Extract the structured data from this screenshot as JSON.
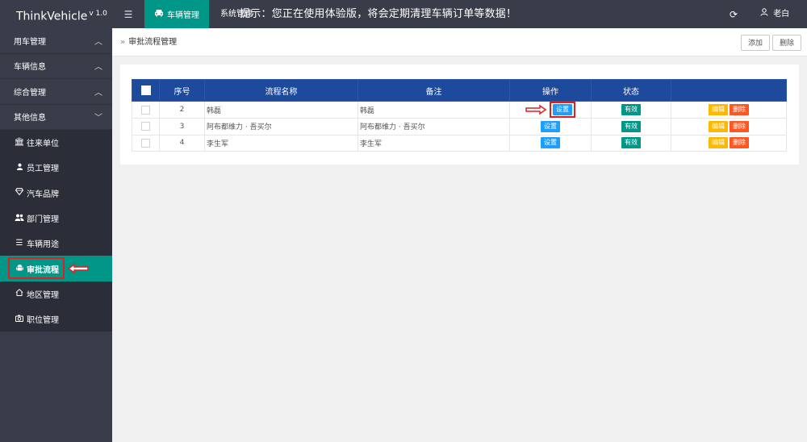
{
  "header": {
    "app_name": "ThinkVehicle",
    "version": "v 1.0",
    "menu_icon": "menu-icon",
    "active_tab": "车辆管理",
    "tab2": "系统管理",
    "notice": "提示：您正在使用体验版，将会定期清理车辆订单等数据！",
    "user": "老白",
    "accent": "#009688",
    "bg": "#393d49"
  },
  "sidebar": {
    "groups": [
      {
        "label": "用车管理",
        "icon": "chevron-up-icon"
      },
      {
        "label": "车辆信息",
        "icon": "chevron-up-icon"
      },
      {
        "label": "综合管理",
        "icon": "chevron-up-icon"
      },
      {
        "label": "其他信息",
        "icon": "chevron-down-icon"
      }
    ],
    "items": [
      {
        "label": "往来单位",
        "icon": "bank-icon"
      },
      {
        "label": "员工管理",
        "icon": "user-icon"
      },
      {
        "label": "汽车品牌",
        "icon": "diamond-icon"
      },
      {
        "label": "部门管理",
        "icon": "users-icon"
      },
      {
        "label": "车辆用途",
        "icon": "list-icon"
      },
      {
        "label": "审批流程",
        "icon": "android-icon"
      },
      {
        "label": "地区管理",
        "icon": "home-icon"
      },
      {
        "label": "职位管理",
        "icon": "camera-icon"
      }
    ]
  },
  "breadcrumb": {
    "current": "审批流程管理"
  },
  "toolbar": {
    "add": "添加",
    "delete": "删除"
  },
  "table": {
    "headers": [
      "",
      "序号",
      "流程名称",
      "备注",
      "操作",
      "状态",
      ""
    ],
    "rows": [
      {
        "no": "2",
        "name": "韩磊",
        "remark": "韩磊",
        "action": "设置",
        "status": "有效",
        "edit": "编辑",
        "del": "删除"
      },
      {
        "no": "3",
        "name": "阿布都维力 · 吾买尔",
        "remark": "阿布都维力 · 吾买尔",
        "action": "设置",
        "status": "有效",
        "edit": "编辑",
        "del": "删除"
      },
      {
        "no": "4",
        "name": "李生军",
        "remark": "李生军",
        "action": "设置",
        "status": "有效",
        "edit": "编辑",
        "del": "删除"
      }
    ]
  }
}
